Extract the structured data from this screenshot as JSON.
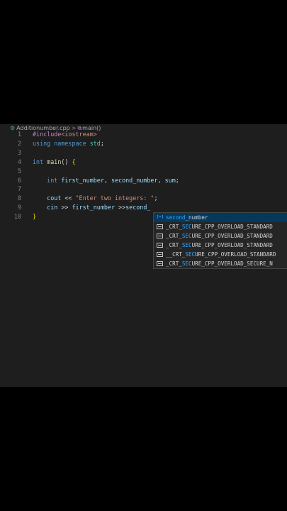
{
  "breadcrumb": {
    "file": "Additionumber.cpp",
    "separator": ">",
    "function": "main()"
  },
  "editor": {
    "lines": [
      {
        "n": "1",
        "parts": [
          [
            "pp",
            "#include"
          ],
          [
            "str",
            "<iostream>"
          ]
        ]
      },
      {
        "n": "2",
        "parts": [
          [
            "kw",
            "using"
          ],
          [
            "plain",
            " "
          ],
          [
            "kw",
            "namespace"
          ],
          [
            "plain",
            " "
          ],
          [
            "ns",
            "std"
          ],
          [
            "plain",
            ";"
          ]
        ]
      },
      {
        "n": "3",
        "parts": []
      },
      {
        "n": "4",
        "parts": [
          [
            "kw",
            "int"
          ],
          [
            "plain",
            " "
          ],
          [
            "fn",
            "main"
          ],
          [
            "plain",
            "() "
          ],
          [
            "br",
            "{"
          ]
        ]
      },
      {
        "n": "5",
        "parts": []
      },
      {
        "n": "6",
        "parts": [
          [
            "plain",
            "    "
          ],
          [
            "kw",
            "int"
          ],
          [
            "plain",
            " "
          ],
          [
            "var",
            "first_number"
          ],
          [
            "plain",
            ", "
          ],
          [
            "var",
            "second_number"
          ],
          [
            "plain",
            ", "
          ],
          [
            "var",
            "sum"
          ],
          [
            "plain",
            ";"
          ]
        ]
      },
      {
        "n": "7",
        "parts": []
      },
      {
        "n": "8",
        "parts": [
          [
            "plain",
            "    "
          ],
          [
            "var",
            "cout"
          ],
          [
            "plain",
            " << "
          ],
          [
            "str",
            "\"Enter two integers: \""
          ],
          [
            "plain",
            ";"
          ]
        ]
      },
      {
        "n": "9",
        "parts": [
          [
            "plain",
            "    "
          ],
          [
            "var",
            "cin"
          ],
          [
            "plain",
            " >> "
          ],
          [
            "var",
            "first_number"
          ],
          [
            "plain",
            " >>"
          ],
          [
            "var",
            "second_"
          ]
        ]
      },
      {
        "n": "10",
        "parts": [
          [
            "br",
            "}"
          ]
        ]
      }
    ]
  },
  "suggestions": [
    {
      "kind": "variable",
      "match": "second",
      "rest": "_number",
      "selected": true
    },
    {
      "kind": "macro",
      "prefix": "_CRT_",
      "match": "SEC",
      "rest": "URE_CPP_OVERLOAD_STANDARD",
      "selected": false
    },
    {
      "kind": "macro",
      "prefix": "_CRT_",
      "match": "SEC",
      "rest": "URE_CPP_OVERLOAD_STANDARD",
      "selected": false
    },
    {
      "kind": "macro",
      "prefix": "_CRT_",
      "match": "SEC",
      "rest": "URE_CPP_OVERLOAD_STANDARD",
      "selected": false
    },
    {
      "kind": "macro",
      "prefix": "__CRT_",
      "match": "SEC",
      "rest": "URE_CPP_OVERLOAD_STANDARD",
      "selected": false
    },
    {
      "kind": "macro",
      "prefix": "_CRT_",
      "match": "SEC",
      "rest": "URE_CPP_OVERLOAD_SECURE_N",
      "selected": false
    }
  ],
  "colors": {
    "editor_bg": "#1e1e1e",
    "suggest_bg": "#252526",
    "suggest_selected": "#04395e",
    "match_highlight": "#2aaaff"
  }
}
